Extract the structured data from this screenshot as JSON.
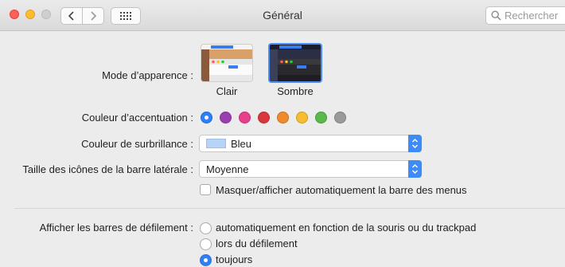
{
  "window": {
    "title": "Général"
  },
  "search": {
    "placeholder": "Rechercher"
  },
  "appearance": {
    "label": "Mode d’apparence :",
    "options": [
      "Clair",
      "Sombre"
    ],
    "selected": "Sombre"
  },
  "accent": {
    "label": "Couleur d’accentuation :",
    "colors": [
      "#2f7ff7",
      "#9a3fb0",
      "#e83e8c",
      "#d9363e",
      "#ef8a2d",
      "#f7bd2e",
      "#5bb84a",
      "#9a9a9a"
    ],
    "selected_index": 0
  },
  "highlight": {
    "label": "Couleur de surbrillance :",
    "value": "Bleu",
    "color": "#b7d3f8"
  },
  "sidebar_icons": {
    "label": "Taille des icônes de la barre latérale :",
    "value": "Moyenne"
  },
  "menubar": {
    "label": "Masquer/afficher automatiquement la barre des menus",
    "checked": false
  },
  "scrollbars": {
    "label": "Afficher les barres de défilement :",
    "options": [
      "automatiquement en fonction de la souris ou du trackpad",
      "lors du défilement",
      "toujours"
    ],
    "selected_index": 2
  },
  "icons": {
    "back": "chevron-left-icon",
    "forward": "chevron-right-icon",
    "grid": "grid-icon",
    "search": "magnifier-icon",
    "popup": "updown-chevron-icon"
  }
}
